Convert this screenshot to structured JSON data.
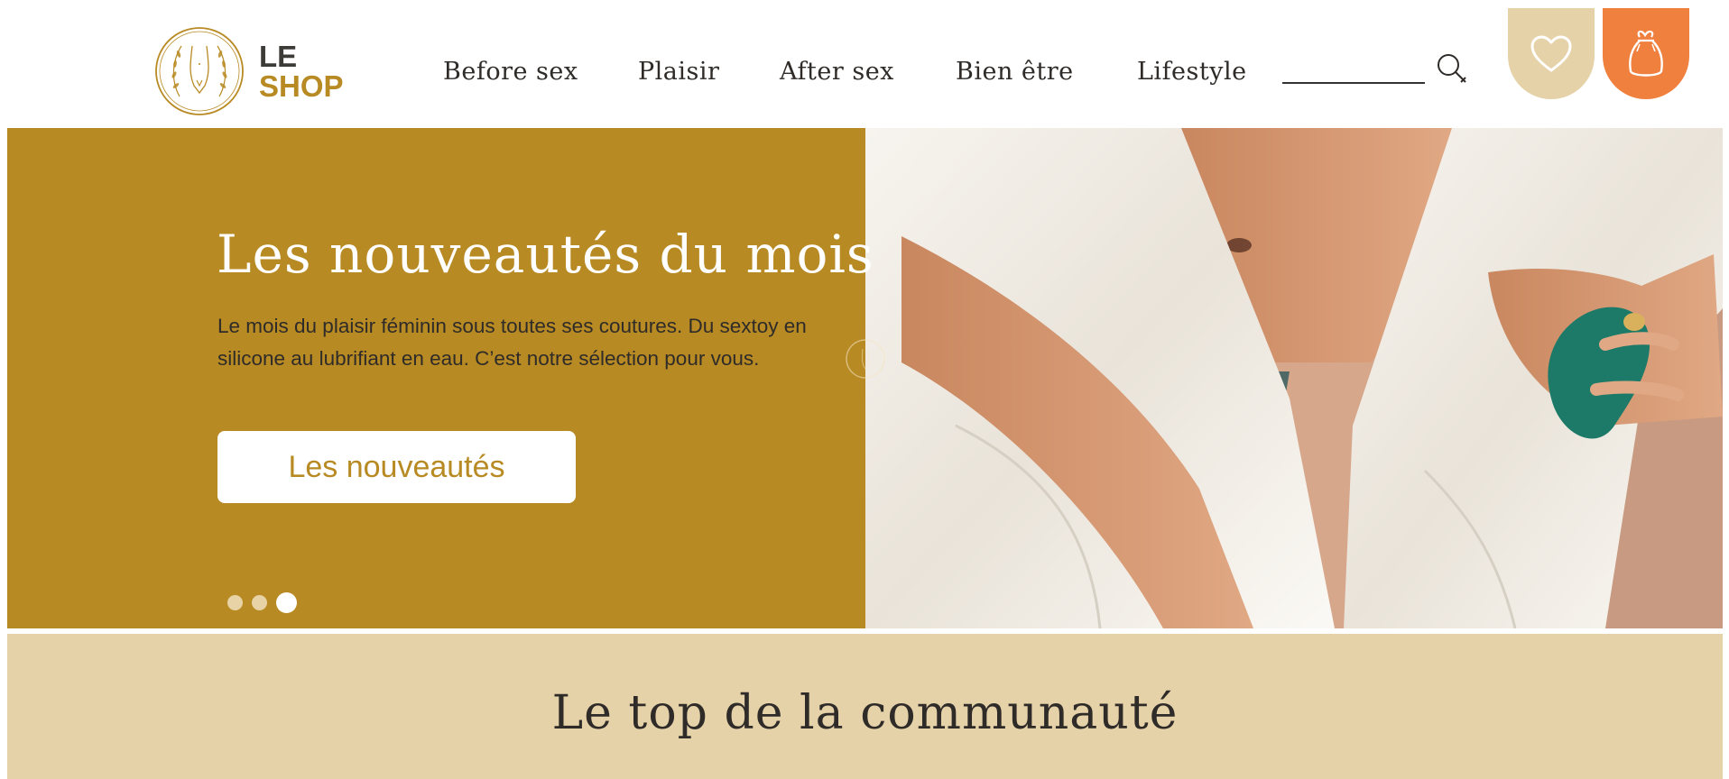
{
  "brand": {
    "logo_line1": "LE",
    "logo_line2": "SHOP",
    "emblem_icon": "woman-silhouette-laurel-emblem"
  },
  "nav": {
    "items": [
      {
        "label": "Before sex"
      },
      {
        "label": "Plaisir"
      },
      {
        "label": "After sex"
      },
      {
        "label": "Bien être"
      },
      {
        "label": "Lifestyle"
      }
    ]
  },
  "search": {
    "value": "",
    "placeholder": "",
    "icon": "search-icon"
  },
  "actions": {
    "wishlist_icon": "heart-icon",
    "cart_icon": "gift-bag-icon"
  },
  "hero": {
    "title": "Les nouveautés du mois",
    "description": "Le mois du plaisir féminin sous toutes ses coutures. Du sextoy en silicone au lubrifiant en eau. C’est notre sélection pour vous.",
    "cta_label": "Les nouveautés",
    "slides_total": 3,
    "active_slide": 3
  },
  "community": {
    "title": "Le top de la communauté",
    "subtitle": ""
  },
  "colors": {
    "gold": "#b88a23",
    "beige": "#e6d2a8",
    "orange": "#f0803e",
    "dark": "#2e2b28"
  }
}
